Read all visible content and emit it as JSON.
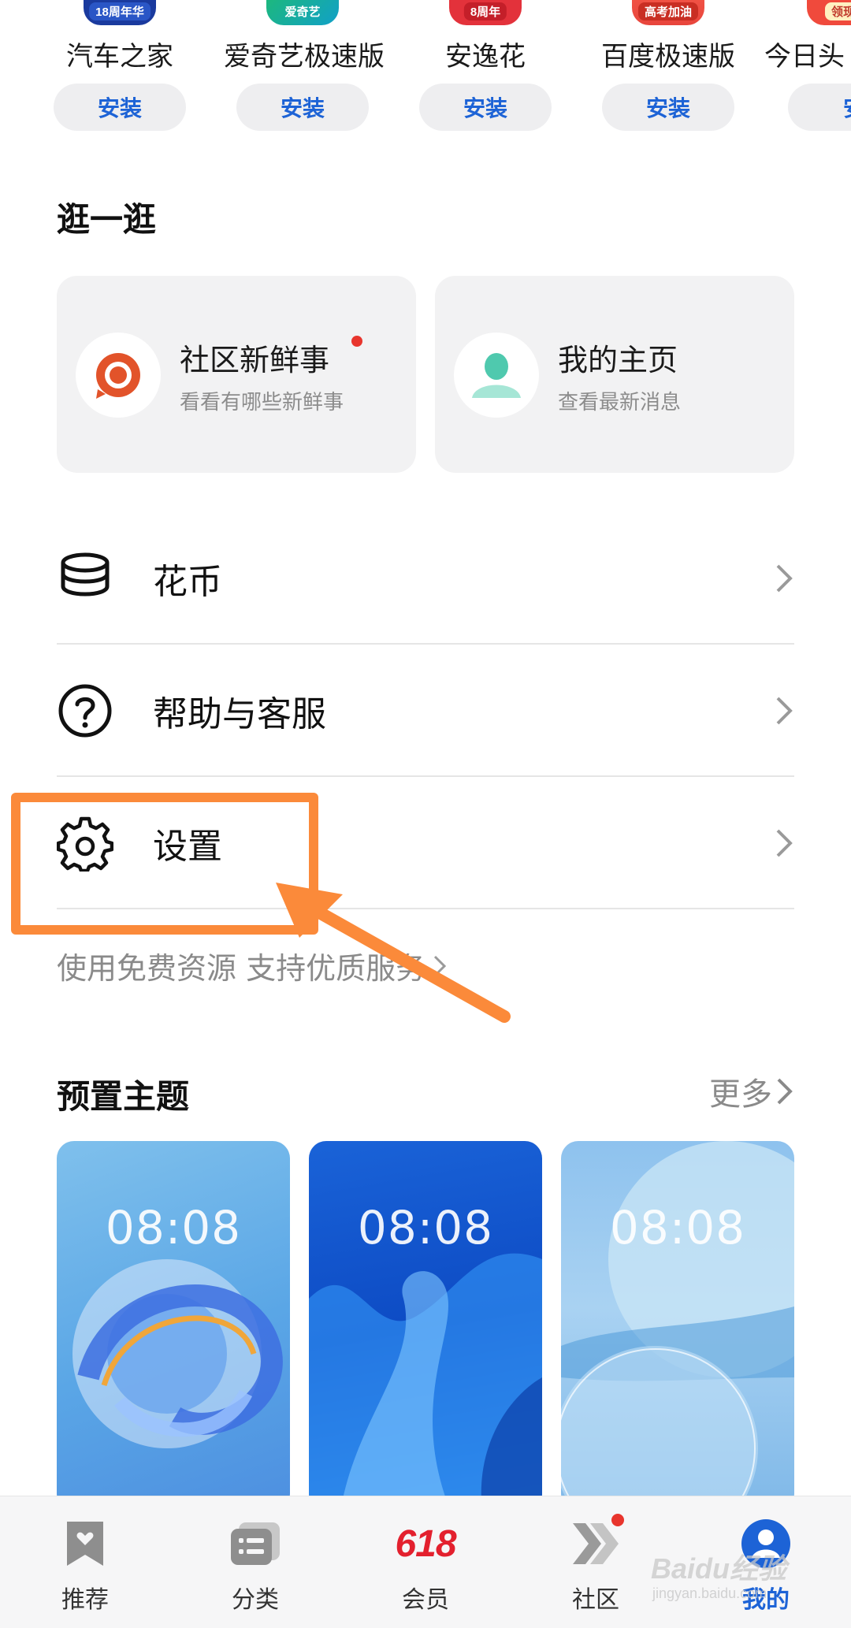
{
  "apps": [
    {
      "name": "汽车之家",
      "install": "安装",
      "badge": "18周年华",
      "color": "#1a3a9e"
    },
    {
      "name": "爱奇艺极速版",
      "install": "安装",
      "badge": "爱奇艺",
      "color": "#27b34a"
    },
    {
      "name": "安逸花",
      "install": "安装",
      "badge": "8周年",
      "color": "#e3323b"
    },
    {
      "name": "百度极速版",
      "install": "安装",
      "badge": "高考加油",
      "color": "#e8453c"
    },
    {
      "name": "今日头",
      "install": "安",
      "badge": "领现",
      "color": "#f04a3c"
    }
  ],
  "browse": {
    "title": "逛一逛",
    "cards": [
      {
        "title": "社区新鲜事",
        "subtitle": "看看有哪些新鲜事"
      },
      {
        "title": "我的主页",
        "subtitle": "查看最新消息"
      }
    ]
  },
  "menu": [
    {
      "label": "花币"
    },
    {
      "label": "帮助与客服"
    },
    {
      "label": "设置"
    }
  ],
  "free_resources": "使用免费资源 支持优质服务",
  "themes": {
    "title": "预置主题",
    "more": "更多",
    "items": [
      {
        "time": "08:08"
      },
      {
        "time": "08:08"
      },
      {
        "time": "08:08"
      }
    ]
  },
  "tabs": [
    {
      "label": "推荐"
    },
    {
      "label": "分类"
    },
    {
      "label": "会员",
      "icon_text": "618"
    },
    {
      "label": "社区"
    },
    {
      "label": "我的"
    }
  ],
  "watermark": {
    "brand": "Baidu经验",
    "url": "jingyan.baidu.com"
  },
  "colors": {
    "accent": "#1d63d6",
    "highlight": "#fb8a3a",
    "badge_red": "#e8352d"
  }
}
